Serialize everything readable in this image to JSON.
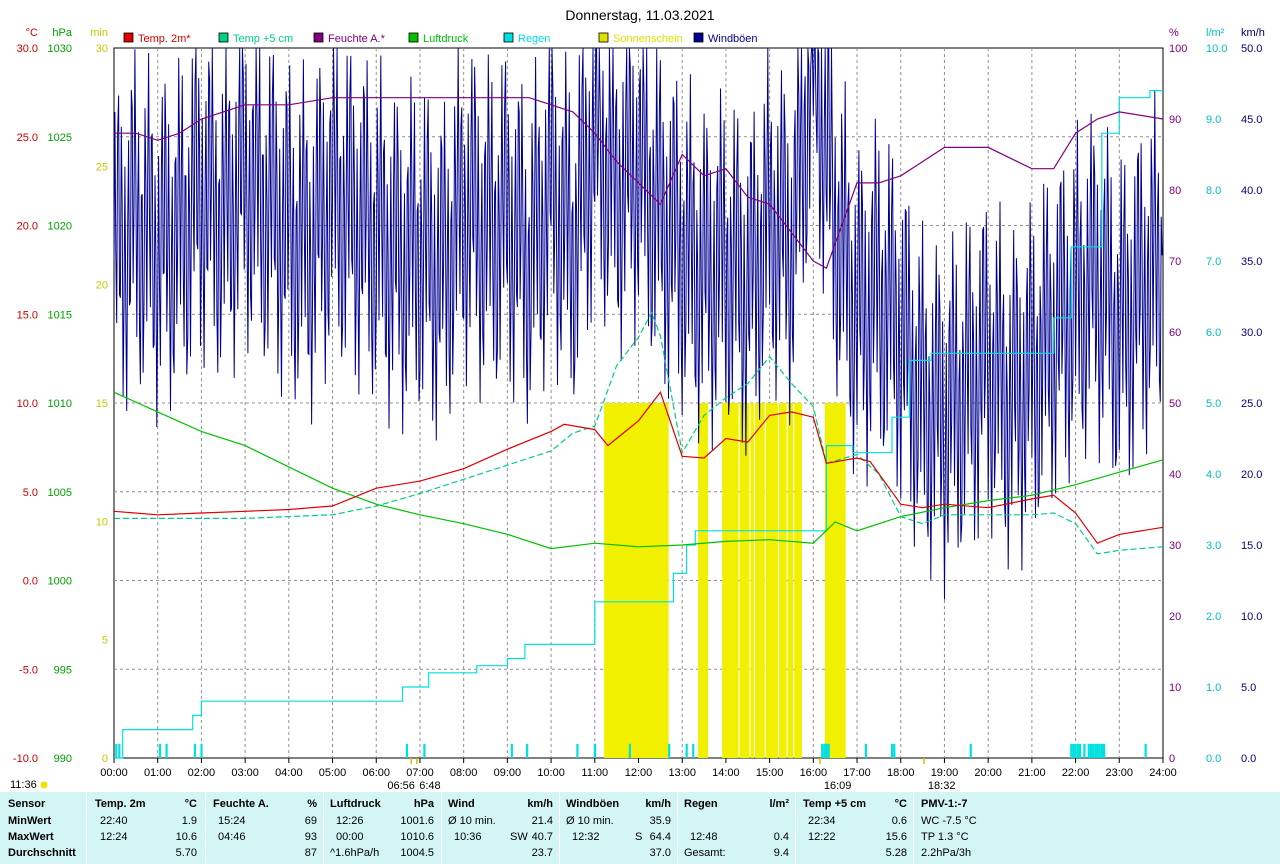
{
  "chart_data": {
    "type": "line",
    "title": "Donnerstag, 11.03.2021",
    "x_ticks": [
      "00:00",
      "01:00",
      "02:00",
      "03:00",
      "04:00",
      "05:00",
      "06:00",
      "07:00",
      "08:00",
      "09:00",
      "10:00",
      "11:00",
      "12:00",
      "13:00",
      "14:00",
      "15:00",
      "16:00",
      "17:00",
      "18:00",
      "19:00",
      "20:00",
      "21:00",
      "22:00",
      "23:00",
      "24:00"
    ],
    "x_range_h": [
      0,
      24
    ],
    "axes": [
      {
        "unit": "°C",
        "color": "#d00000",
        "ticks": [
          "30.0",
          "25.0",
          "20.0",
          "15.0",
          "10.0",
          "5.0",
          "0.0",
          "-5.0",
          "-10.0"
        ],
        "range": [
          -10,
          30
        ]
      },
      {
        "unit": "hPa",
        "color": "#00a000",
        "ticks": [
          "1030",
          "1025",
          "1020",
          "1015",
          "1010",
          "1005",
          "1000",
          "995",
          "990"
        ],
        "range": [
          990,
          1030
        ]
      },
      {
        "unit": "min",
        "color": "#c8c800",
        "ticks": [
          "30",
          "25",
          "20",
          "15",
          "10",
          "5",
          "0"
        ],
        "range": [
          0,
          30
        ]
      },
      {
        "unit": "%",
        "color": "#800080",
        "ticks": [
          "100",
          "90",
          "80",
          "70",
          "60",
          "50",
          "40",
          "30",
          "20",
          "10",
          "0"
        ],
        "range": [
          0,
          100
        ]
      },
      {
        "unit": "l/m²",
        "color": "#00c0c0",
        "ticks": [
          "10.0",
          "9.0",
          "8.0",
          "7.0",
          "6.0",
          "5.0",
          "4.0",
          "3.0",
          "2.0",
          "1.0",
          "0.0"
        ],
        "range": [
          0,
          10
        ]
      },
      {
        "unit": "km/h",
        "color": "#000080",
        "ticks": [
          "50.0",
          "45.0",
          "40.0",
          "35.0",
          "30.0",
          "25.0",
          "20.0",
          "15.0",
          "10.0",
          "5.0",
          "0.0"
        ],
        "range": [
          0,
          50
        ]
      }
    ],
    "legend": [
      {
        "name": "Temp. 2m*",
        "color": "#e00000"
      },
      {
        "name": "Temp +5 cm",
        "color": "#00d080"
      },
      {
        "name": "Feuchte A.*",
        "color": "#800080"
      },
      {
        "name": "Luftdruck",
        "color": "#00c000"
      },
      {
        "name": "Regen",
        "color": "#00e0e0"
      },
      {
        "name": "Sonnenschein",
        "color": "#e0e000"
      },
      {
        "name": "Windböen",
        "color": "#000090"
      }
    ],
    "series": [
      {
        "name": "Temp. 2m*",
        "axis": "°C",
        "color": "#e00000",
        "x": [
          0,
          1,
          2,
          3,
          4,
          5,
          6,
          7,
          8,
          9,
          10,
          10.3,
          11,
          11.3,
          12,
          12.5,
          13,
          13.5,
          14,
          14.5,
          15,
          15.5,
          16,
          16.3,
          17,
          17.3,
          18,
          18.5,
          19,
          20,
          21,
          21.5,
          22,
          22.5,
          23,
          24
        ],
        "y": [
          3.9,
          3.7,
          3.8,
          3.9,
          4,
          4.2,
          5.2,
          5.6,
          6.3,
          7.4,
          8.4,
          8.8,
          8.5,
          7.6,
          9,
          10.6,
          7,
          6.9,
          8,
          7.8,
          9.3,
          9.5,
          9.2,
          6.6,
          6.9,
          6.7,
          4.3,
          4.1,
          4.3,
          4.1,
          4.6,
          4.8,
          3.8,
          2.1,
          2.6,
          3
        ]
      },
      {
        "name": "Temp +5 cm",
        "axis": "°C",
        "color": "#00d080",
        "x": [
          0,
          1,
          2,
          3,
          4,
          5,
          6,
          7,
          8,
          9,
          10,
          10.5,
          11,
          11.5,
          12,
          12.3,
          12.5,
          13,
          13.5,
          14,
          14.5,
          15,
          15.5,
          16,
          16.3,
          17,
          17.5,
          18,
          18.5,
          19,
          20,
          21,
          21.5,
          22,
          22.5,
          23,
          24
        ],
        "y": [
          3.5,
          3.5,
          3.5,
          3.5,
          3.6,
          3.7,
          4.2,
          4.9,
          5.7,
          6.5,
          7.3,
          8.3,
          8.7,
          12.1,
          13.7,
          15.1,
          13.8,
          7.2,
          9.3,
          10.3,
          11.1,
          12.6,
          11.1,
          9.8,
          6.6,
          7.1,
          6,
          3.6,
          3.2,
          3.7,
          3.7,
          3.7,
          3.8,
          3.2,
          1.5,
          1.7,
          1.9
        ]
      },
      {
        "name": "Feuchte A.*",
        "axis": "%",
        "color": "#800080",
        "x": [
          0,
          0.5,
          1,
          1.5,
          2,
          3,
          4,
          5,
          6,
          7,
          8,
          9,
          9.5,
          10,
          10.5,
          11,
          11.5,
          12,
          12.5,
          13,
          13.5,
          14,
          14.5,
          15,
          15.5,
          16,
          16.3,
          17,
          17.5,
          18,
          18.5,
          19,
          20,
          21,
          21.5,
          22,
          22.5,
          23,
          24
        ],
        "y": [
          88,
          88,
          87,
          88,
          90,
          92,
          92,
          93,
          93,
          93,
          93,
          93,
          93,
          92,
          91,
          88,
          84,
          81,
          78,
          85,
          82,
          83,
          79,
          78,
          74,
          70,
          69,
          81,
          81,
          82,
          84,
          86,
          86,
          83,
          83,
          88,
          90,
          91,
          90
        ]
      },
      {
        "name": "Luftdruck",
        "axis": "hPa",
        "color": "#00c000",
        "x": [
          0,
          1,
          2,
          3,
          4,
          5,
          6,
          7,
          8,
          9,
          10,
          11,
          12,
          13,
          14,
          15,
          16,
          16.5,
          17,
          18,
          19,
          20,
          21,
          22,
          23,
          24
        ],
        "y": [
          1010.6,
          1009.5,
          1008.4,
          1007.6,
          1006.4,
          1005.2,
          1004.3,
          1003.7,
          1003.2,
          1002.6,
          1001.8,
          1002.1,
          1001.9,
          1002,
          1002.2,
          1002.3,
          1002.1,
          1003.3,
          1002.8,
          1003.6,
          1004.1,
          1004.5,
          1004.8,
          1005.4,
          1006.1,
          1006.8
        ]
      },
      {
        "name": "Regen",
        "axis": "l/m²",
        "color": "#00e0e0",
        "x": [
          0,
          0.2,
          0.2,
          1.8,
          1.8,
          2,
          2,
          6.6,
          6.6,
          7.2,
          7.2,
          8.3,
          8.3,
          9,
          9,
          9.4,
          9.4,
          11,
          11,
          12.8,
          12.8,
          13.1,
          13.1,
          13.3,
          13.3,
          16.3,
          16.3,
          16.9,
          16.9,
          17.8,
          17.8,
          18.2,
          18.2,
          18.7,
          18.7,
          21.5,
          21.5,
          21.9,
          21.9,
          22.6,
          22.6,
          23,
          23,
          23.7,
          23.7,
          24
        ],
        "y": [
          0,
          0,
          0.4,
          0.4,
          0.6,
          0.6,
          0.8,
          0.8,
          1,
          1,
          1.2,
          1.2,
          1.3,
          1.3,
          1.4,
          1.4,
          1.6,
          1.6,
          2.2,
          2.2,
          2.6,
          2.6,
          3,
          3,
          3.2,
          3.2,
          4.4,
          4.4,
          4.3,
          4.3,
          4.8,
          4.8,
          5.6,
          5.6,
          5.7,
          5.7,
          6.2,
          6.2,
          7.2,
          7.2,
          8.8,
          8.8,
          9.3,
          9.3,
          9.4,
          9.4
        ]
      },
      {
        "name": "Windböen",
        "axis": "km/h",
        "color": "#000090",
        "x": [
          0,
          0.5,
          1,
          1.5,
          2,
          2.5,
          3,
          3.5,
          4,
          4.5,
          5,
          5.5,
          6,
          6.5,
          7,
          7.5,
          8,
          8.5,
          9,
          9.5,
          10,
          10.5,
          11,
          11.5,
          12,
          12.5,
          13,
          13.5,
          14,
          14.5,
          15,
          15.5,
          16,
          16.5,
          17,
          17.5,
          18,
          18.5,
          19,
          19.5,
          20,
          20.5,
          21,
          21.5,
          22,
          22.5,
          23,
          23.5,
          24
        ],
        "y": [
          35,
          38,
          36,
          37,
          40,
          38,
          41,
          39,
          37,
          36,
          40,
          38,
          37,
          35,
          36,
          34,
          39,
          37,
          38,
          35,
          40,
          36,
          44,
          40,
          42,
          38,
          36,
          34,
          35,
          33,
          38,
          36,
          50,
          38,
          31,
          33,
          30,
          25,
          24,
          26,
          28,
          25,
          27,
          30,
          32,
          34,
          30,
          33,
          35
        ]
      }
    ],
    "wind_band_min_kmh": 40,
    "sunshine_hours": [
      11.25,
      11.3,
      11.35,
      11.4,
      11.45,
      11.5,
      11.55,
      11.6,
      11.65,
      11.7,
      11.75,
      11.8,
      11.85,
      11.9,
      11.95,
      12,
      12.05,
      12.1,
      12.15,
      12.2,
      12.25,
      12.3,
      12.35,
      12.4,
      12.45,
      12.5,
      12.55,
      12.6,
      12.65,
      13.4,
      13.45,
      13.5,
      13.55,
      13.95,
      14,
      14.05,
      14.1,
      14.15,
      14.2,
      14.25,
      14.35,
      14.4,
      14.45,
      14.5,
      14.6,
      14.7,
      14.75,
      14.8,
      14.85,
      14.95,
      15,
      15.05,
      15.1,
      15.15,
      15.25,
      15.3,
      15.35,
      15.45,
      15.5,
      15.6,
      15.65,
      15.7,
      16.3,
      16.35,
      16.4,
      16.45,
      16.5,
      16.55,
      16.6,
      16.65,
      16.7
    ],
    "sunshine_minutes": 15,
    "rain_event_hours": [
      0.05,
      0.12,
      1.05,
      1.2,
      1.85,
      2.0,
      6.7,
      7.1,
      9.1,
      9.45,
      10.6,
      11.0,
      11.8,
      12.7,
      13.1,
      13.25,
      16.2,
      16.25,
      16.3,
      16.35,
      17.2,
      17.8,
      17.85,
      19.6,
      21.9,
      21.95,
      22.0,
      22.05,
      22.1,
      22.2,
      22.3,
      22.35,
      22.4,
      22.45,
      22.5,
      22.55,
      22.6,
      22.65,
      23.6
    ],
    "rain_event_mm": 0.2,
    "markers": [
      {
        "label": "06:56",
        "x": 6.93
      },
      {
        "label": "6:48",
        "x": 6.8
      },
      {
        "label": "16:09",
        "x": 16.15
      },
      {
        "label": "18:32",
        "x": 18.53
      },
      {
        "label": "11:36",
        "x": 11.6
      }
    ]
  },
  "table": {
    "sensor": {
      "head": "Sensor",
      "min": "MinWert",
      "max": "MaxWert",
      "avg": "Durchschnitt"
    },
    "temp2m": {
      "head": "Temp. 2m",
      "unit": "°C",
      "min_time": "22:40",
      "min_val": "1.9",
      "max_time": "12:24",
      "max_val": "10.6",
      "avg_val": "5.70"
    },
    "feuchte": {
      "head": "Feuchte A.",
      "unit": "%",
      "min_time": "15:24",
      "min_val": "69",
      "max_time": "04:46",
      "max_val": "93",
      "avg_val": "87"
    },
    "luftdruck": {
      "head": "Luftdruck",
      "unit": "hPa",
      "min_time": "12:26",
      "min_val": "1001.6",
      "max_time": "00:00",
      "max_val": "1010.6",
      "avg_label": "^1.6hPa/h",
      "avg_val": "1004.5"
    },
    "wind": {
      "head": "Wind",
      "unit": "km/h",
      "min_time": "Ø 10 min.",
      "min_val": "21.4",
      "max_time": "10:36",
      "max_dir": "SW",
      "max_val": "40.7",
      "avg_val": "23.7"
    },
    "boeen": {
      "head": "Windböen",
      "unit": "km/h",
      "min_time": "Ø 10 min.",
      "min_val": "35.9",
      "max_time": "12:32",
      "max_dir": "S",
      "max_val": "64.4",
      "avg_val": "37.0"
    },
    "regen": {
      "head": "Regen",
      "unit": "l/m²",
      "max_time": "12:48",
      "max_val": "0.4",
      "avg_label": "Gesamt:",
      "avg_val": "9.4"
    },
    "temp5": {
      "head": "Temp +5 cm",
      "unit": "°C",
      "min_time": "22:34",
      "min_val": "0.6",
      "max_time": "12:22",
      "max_val": "15.6",
      "avg_val": "5.28"
    },
    "pmv": {
      "head": "PMV-1:-7",
      "min_text": "WC -7.5 °C",
      "max_text": "TP 1.3 °C",
      "avg_text": "2.2hPa/3h"
    }
  }
}
